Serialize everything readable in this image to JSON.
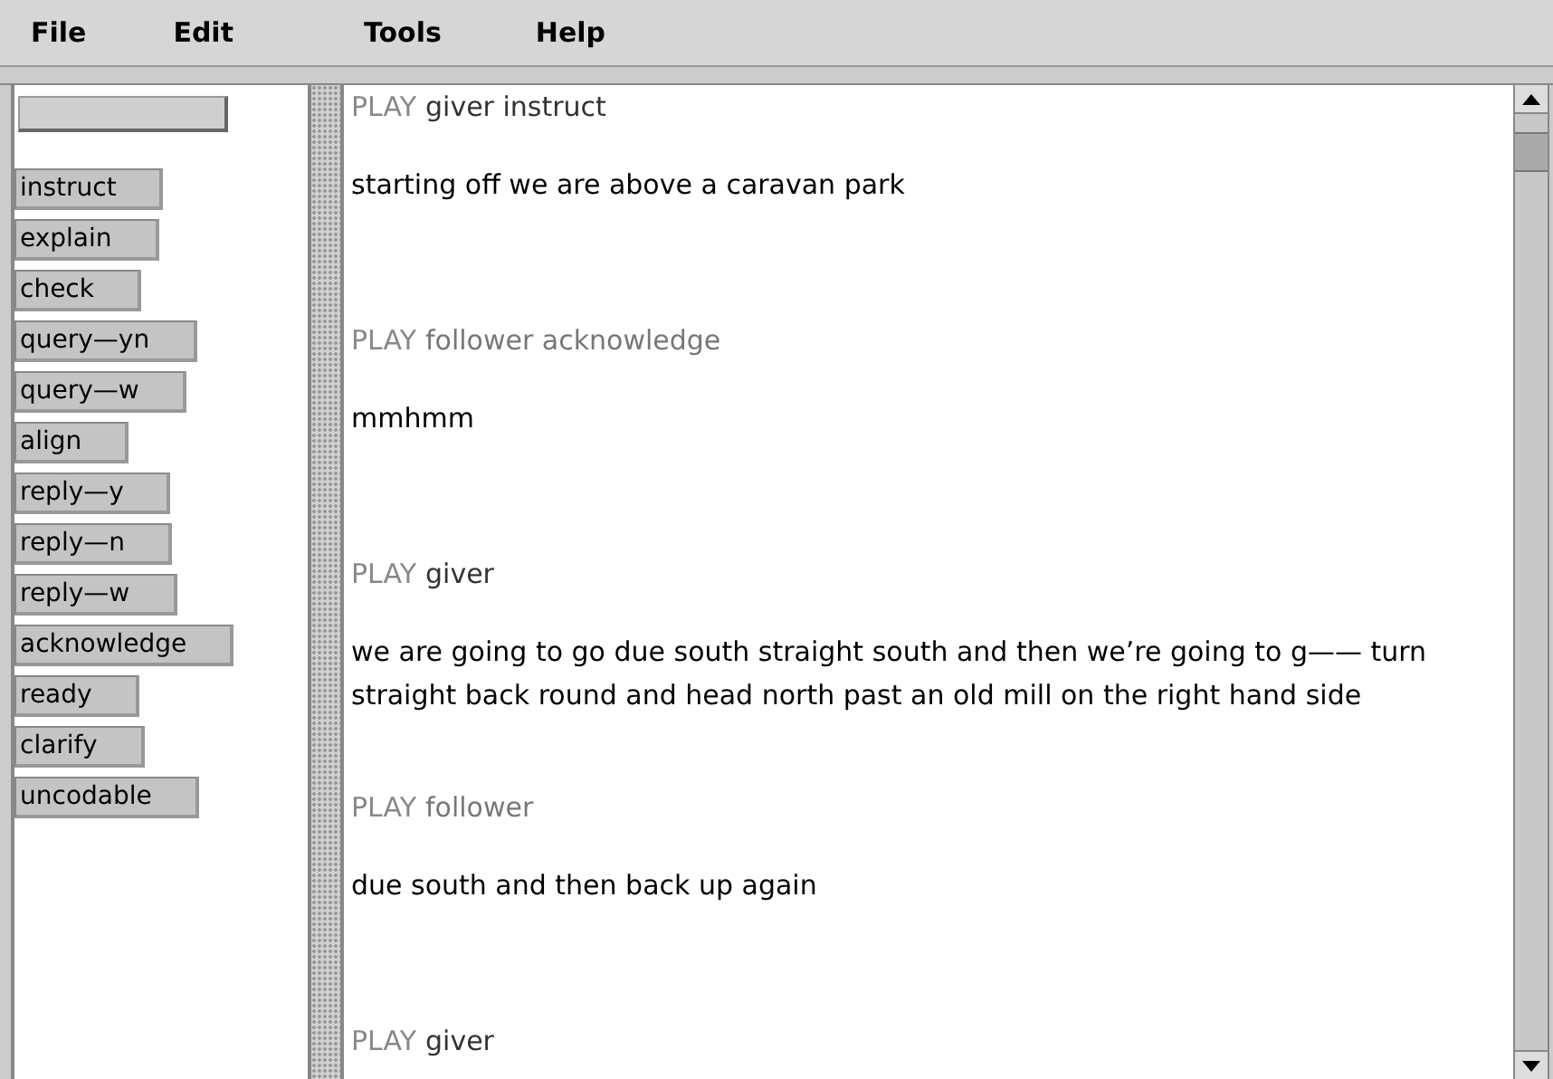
{
  "menu": [
    "File",
    "Edit",
    "Tools",
    "Help"
  ],
  "codes": [
    {
      "label": "instruct"
    },
    {
      "label": "explain"
    },
    {
      "label": "check"
    },
    {
      "label": "query—yn"
    },
    {
      "label": "query—w"
    },
    {
      "label": "align"
    },
    {
      "label": "reply—y"
    },
    {
      "label": "reply—n"
    },
    {
      "label": "reply—w"
    },
    {
      "label": "acknowledge"
    },
    {
      "label": "ready"
    },
    {
      "label": "clarify"
    },
    {
      "label": "uncodable"
    }
  ],
  "transcript": [
    {
      "play": "PLAY",
      "header": "giver instruct",
      "kind": "giver",
      "text": "starting off we are above a caravan park"
    },
    {
      "play": "PLAY",
      "header": "follower acknowledge",
      "kind": "follower",
      "text": "mmhmm"
    },
    {
      "play": "PLAY",
      "header": "giver",
      "kind": "giver",
      "text": "we are going to go due south straight south and then we’re going to g—— turn straight back round and head north past an old mill on the right hand side"
    },
    {
      "play": "PLAY",
      "header": "follower",
      "kind": "follower",
      "text": "due south and then back up again"
    },
    {
      "play": "PLAY",
      "header": "giver",
      "kind": "giver"
    }
  ]
}
